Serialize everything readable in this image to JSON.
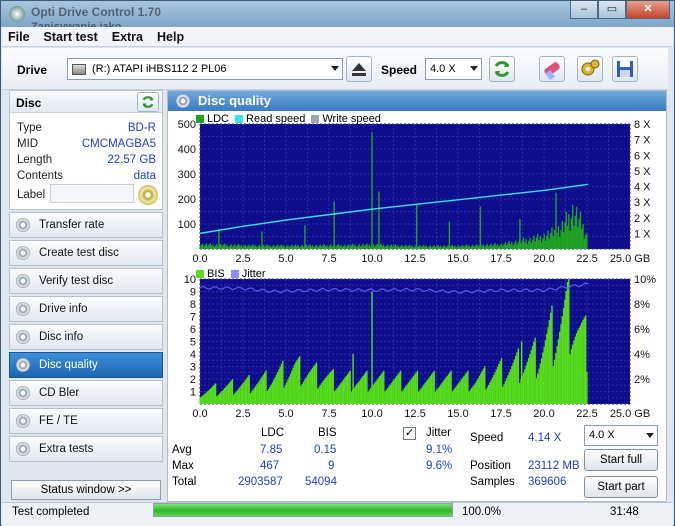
{
  "window": {
    "title": "Opti Drive Control 1.70",
    "subtitle": "Zapisywanie jako"
  },
  "menu": [
    "File",
    "Start test",
    "Extra",
    "Help"
  ],
  "toolbar": {
    "drive_label": "Drive",
    "drive_value": "(R:)   ATAPI iHBS112   2 PL06",
    "speed_label": "Speed",
    "speed_value": "4.0 X"
  },
  "disc": {
    "header": "Disc",
    "type_label": "Type",
    "type_value": "BD-R",
    "mid_label": "MID",
    "mid_value": "CMCMAGBA5",
    "length_label": "Length",
    "length_value": "22.57 GB",
    "contents_label": "Contents",
    "contents_value": "data",
    "label_label": "Label"
  },
  "nav": [
    "Transfer rate",
    "Create test disc",
    "Verify test disc",
    "Drive info",
    "Disc info",
    "Disc quality",
    "CD Bler",
    "FE / TE",
    "Extra tests"
  ],
  "nav_active": "Disc quality",
  "status_window_label": "Status window >>",
  "panel": {
    "title": "Disc quality"
  },
  "chart_data": [
    {
      "type": "bar",
      "legend": [
        "LDC",
        "Read speed",
        "Write speed"
      ],
      "colors": {
        "ldc": "#1fa51f",
        "read_speed": "#35e2ef",
        "write_speed": "#9aa6ae"
      },
      "y_ticks": [
        "500",
        "400",
        "300",
        "200",
        "100"
      ],
      "y2_ticks": [
        "8 X",
        "7 X",
        "6 X",
        "5 X",
        "4 X",
        "3 X",
        "2 X",
        "1 X"
      ],
      "x_ticks": [
        "0.0",
        "2.5",
        "5.0",
        "7.5",
        "10.0",
        "12.5",
        "15.0",
        "17.5",
        "20.0",
        "22.5",
        "25.0 GB"
      ],
      "xlim": [
        0,
        25
      ],
      "ylim": [
        0,
        500
      ],
      "y2lim": [
        0,
        8
      ],
      "ldc_baseline": [
        [
          0,
          18
        ],
        [
          2.5,
          14
        ],
        [
          5,
          13
        ],
        [
          7.5,
          14
        ],
        [
          10,
          16
        ],
        [
          12.5,
          12
        ],
        [
          15,
          12
        ],
        [
          17.5,
          18
        ],
        [
          19,
          35
        ],
        [
          20,
          50
        ],
        [
          21,
          80
        ],
        [
          21.7,
          150
        ],
        [
          22.2,
          100
        ],
        [
          22.57,
          40
        ]
      ],
      "ldc_spikes": [
        [
          10.0,
          467
        ],
        [
          10.4,
          230
        ],
        [
          7.8,
          190
        ],
        [
          12.6,
          180
        ],
        [
          16.3,
          170
        ],
        [
          20.7,
          225
        ],
        [
          6.1,
          95
        ],
        [
          14.5,
          110
        ],
        [
          18.6,
          120
        ],
        [
          1.1,
          80
        ],
        [
          3.6,
          70
        ]
      ],
      "read_speed": [
        [
          0,
          1.0
        ],
        [
          2.5,
          1.45
        ],
        [
          5,
          1.85
        ],
        [
          7.5,
          2.2
        ],
        [
          10,
          2.55
        ],
        [
          12.5,
          2.85
        ],
        [
          15,
          3.15
        ],
        [
          17.5,
          3.45
        ],
        [
          20,
          3.75
        ],
        [
          22.57,
          4.14
        ]
      ]
    },
    {
      "type": "bar",
      "legend": [
        "BIS",
        "Jitter"
      ],
      "colors": {
        "bis": "#57dd1a",
        "jitter": "#5a5ae8"
      },
      "y_ticks": [
        "10",
        "9",
        "8",
        "7",
        "6",
        "5",
        "4",
        "3",
        "2",
        "1"
      ],
      "y2_ticks": [
        "10%",
        "8%",
        "6%",
        "4%",
        "2%"
      ],
      "x_ticks": [
        "0.0",
        "2.5",
        "5.0",
        "7.5",
        "10.0",
        "12.5",
        "15.0",
        "17.5",
        "20.0",
        "22.5",
        "25.0 GB"
      ],
      "xlim": [
        0,
        25
      ],
      "ylim": [
        0,
        10
      ],
      "y2lim": [
        0,
        10
      ],
      "bis_baseline": [
        [
          0,
          1
        ],
        [
          3.8,
          2
        ],
        [
          5.5,
          3
        ],
        [
          8,
          2
        ],
        [
          10,
          2
        ],
        [
          12.5,
          2
        ],
        [
          16,
          2
        ],
        [
          18,
          3
        ],
        [
          19.5,
          4
        ],
        [
          20.5,
          6
        ],
        [
          21.5,
          8
        ],
        [
          22.1,
          6
        ],
        [
          22.57,
          5
        ]
      ],
      "bis_spikes": [
        [
          10.0,
          9
        ],
        [
          8.9,
          4
        ],
        [
          18.7,
          5
        ]
      ],
      "jitter": [
        [
          0,
          9.3
        ],
        [
          2.5,
          9.25
        ],
        [
          4.3,
          9.0
        ],
        [
          7.5,
          9.15
        ],
        [
          10,
          9.1
        ],
        [
          12.5,
          9.15
        ],
        [
          15,
          8.95
        ],
        [
          17.5,
          9.1
        ],
        [
          20,
          9.1
        ],
        [
          22.57,
          9.6
        ]
      ]
    }
  ],
  "stats": {
    "col_ldc": "LDC",
    "col_bis": "BIS",
    "jitter_label": "Jitter",
    "avg_label": "Avg",
    "avg_ldc": "7.85",
    "avg_bis": "0.15",
    "avg_jitter": "9.1%",
    "max_label": "Max",
    "max_ldc": "467",
    "max_bis": "9",
    "max_jitter": "9.6%",
    "total_label": "Total",
    "total_ldc": "2903587",
    "total_bis": "54094",
    "speed_label": "Speed",
    "speed_value": "4.14 X",
    "position_label": "Position",
    "position_value": "23112 MB",
    "samples_label": "Samples",
    "samples_value": "369606",
    "speed_select": "4.0 X",
    "start_full": "Start full",
    "start_part": "Start part"
  },
  "status": {
    "text": "Test completed",
    "progress": 100.0,
    "progress_text": "100.0%",
    "time": "31:48"
  }
}
